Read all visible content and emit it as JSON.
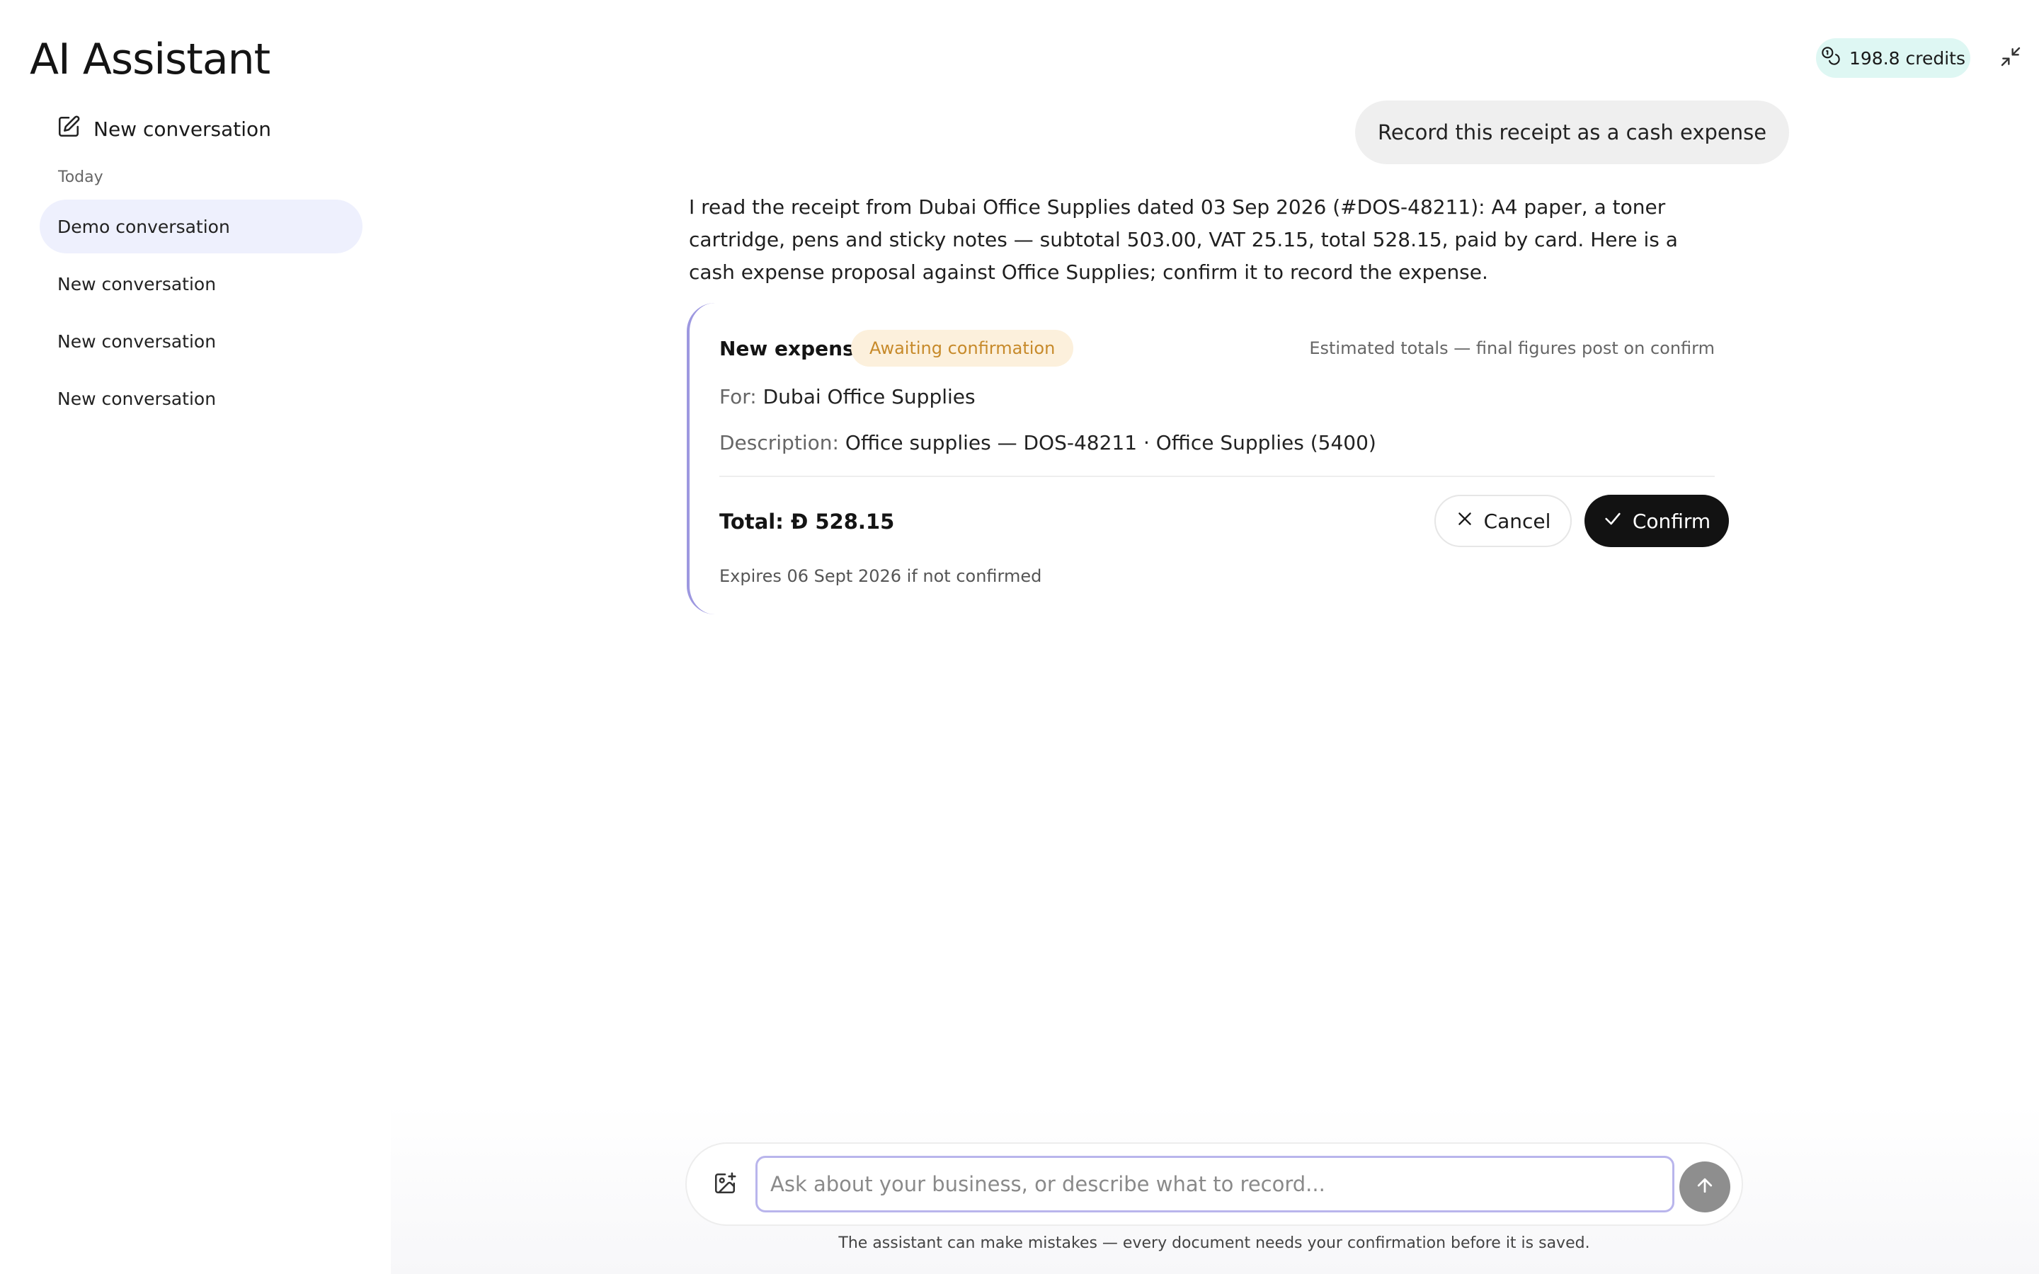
{
  "app": {
    "title": "AI Assistant"
  },
  "header": {
    "credits": "198.8 credits",
    "credits_icon": "coins-icon",
    "collapse_icon": "minimize-icon"
  },
  "sidebar": {
    "new_conversation": "New conversation",
    "section_label": "Today",
    "items": [
      {
        "label": "Demo conversation",
        "active": true
      },
      {
        "label": "New conversation",
        "active": false
      },
      {
        "label": "New conversation",
        "active": false
      },
      {
        "label": "New conversation",
        "active": false
      }
    ]
  },
  "conversation": {
    "user_message": "Record this receipt as a cash expense",
    "assistant_message": "I read the receipt from Dubai Office Supplies dated 03 Sep 2026 (#DOS-48211): A4 paper, a toner cartridge, pens and sticky notes — subtotal 503.00, VAT 25.15, total 528.15, paid by card. Here is a cash expense proposal against Office Supplies; confirm it to record the expense.",
    "card": {
      "title": "New expense",
      "status": "Awaiting confirmation",
      "estimate_note": "Estimated totals — final figures post on confirm",
      "for_label": "For:",
      "for_value": "Dubai Office Supplies",
      "description_label": "Description:",
      "description_value": "Office supplies — DOS-48211 · Office Supplies (5400)",
      "total_label": "Total:",
      "currency_symbol": "Ð",
      "total_value": "528.15",
      "cancel_label": "Cancel",
      "confirm_label": "Confirm",
      "expires": "Expires 06 Sept 2026 if not confirmed"
    }
  },
  "composer": {
    "placeholder": "Ask about your business, or describe what to record...",
    "value": "",
    "disclaimer": "The assistant can make mistakes — every document needs your confirmation before it is saved."
  },
  "colors": {
    "accent": "#9d98e0",
    "credits_bg": "#def7f3",
    "badge_bg": "#fcf0dc",
    "badge_text": "#c78a2a",
    "active_item_bg": "#eef0fd"
  }
}
